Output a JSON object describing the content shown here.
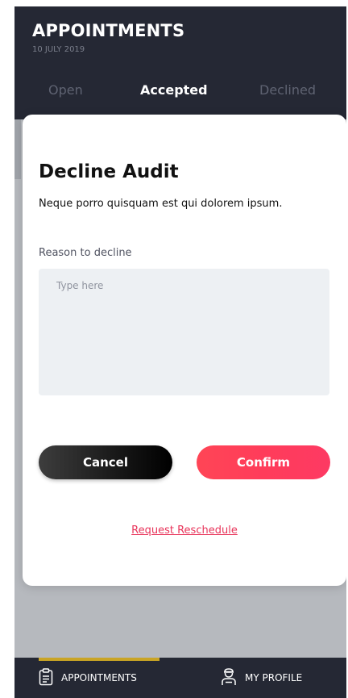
{
  "header": {
    "title": "APPOINTMENTS",
    "date": "10 JULY 2019"
  },
  "tabs": [
    {
      "label": "Open",
      "active": false
    },
    {
      "label": "Accepted",
      "active": true
    },
    {
      "label": "Declined",
      "active": false
    }
  ],
  "modal": {
    "title": "Decline Audit",
    "subtitle": "Neque porro quisquam est qui dolorem ipsum.",
    "reason_label": "Reason to decline",
    "reason_placeholder": "Type here",
    "reason_value": "",
    "cancel_label": "Cancel",
    "confirm_label": "Confirm",
    "reschedule_label": "Request Reschedule"
  },
  "bottom_nav": {
    "items": [
      {
        "label": "APPOINTMENTS",
        "icon": "clipboard-icon",
        "active": true
      },
      {
        "label": "MY PROFILE",
        "icon": "user-icon",
        "active": false
      }
    ]
  },
  "colors": {
    "header_bg": "#252834",
    "tab_accent": "#e0495f",
    "confirm": "#ff4556",
    "link": "#e8345a",
    "nav_accent": "#c9a425"
  }
}
